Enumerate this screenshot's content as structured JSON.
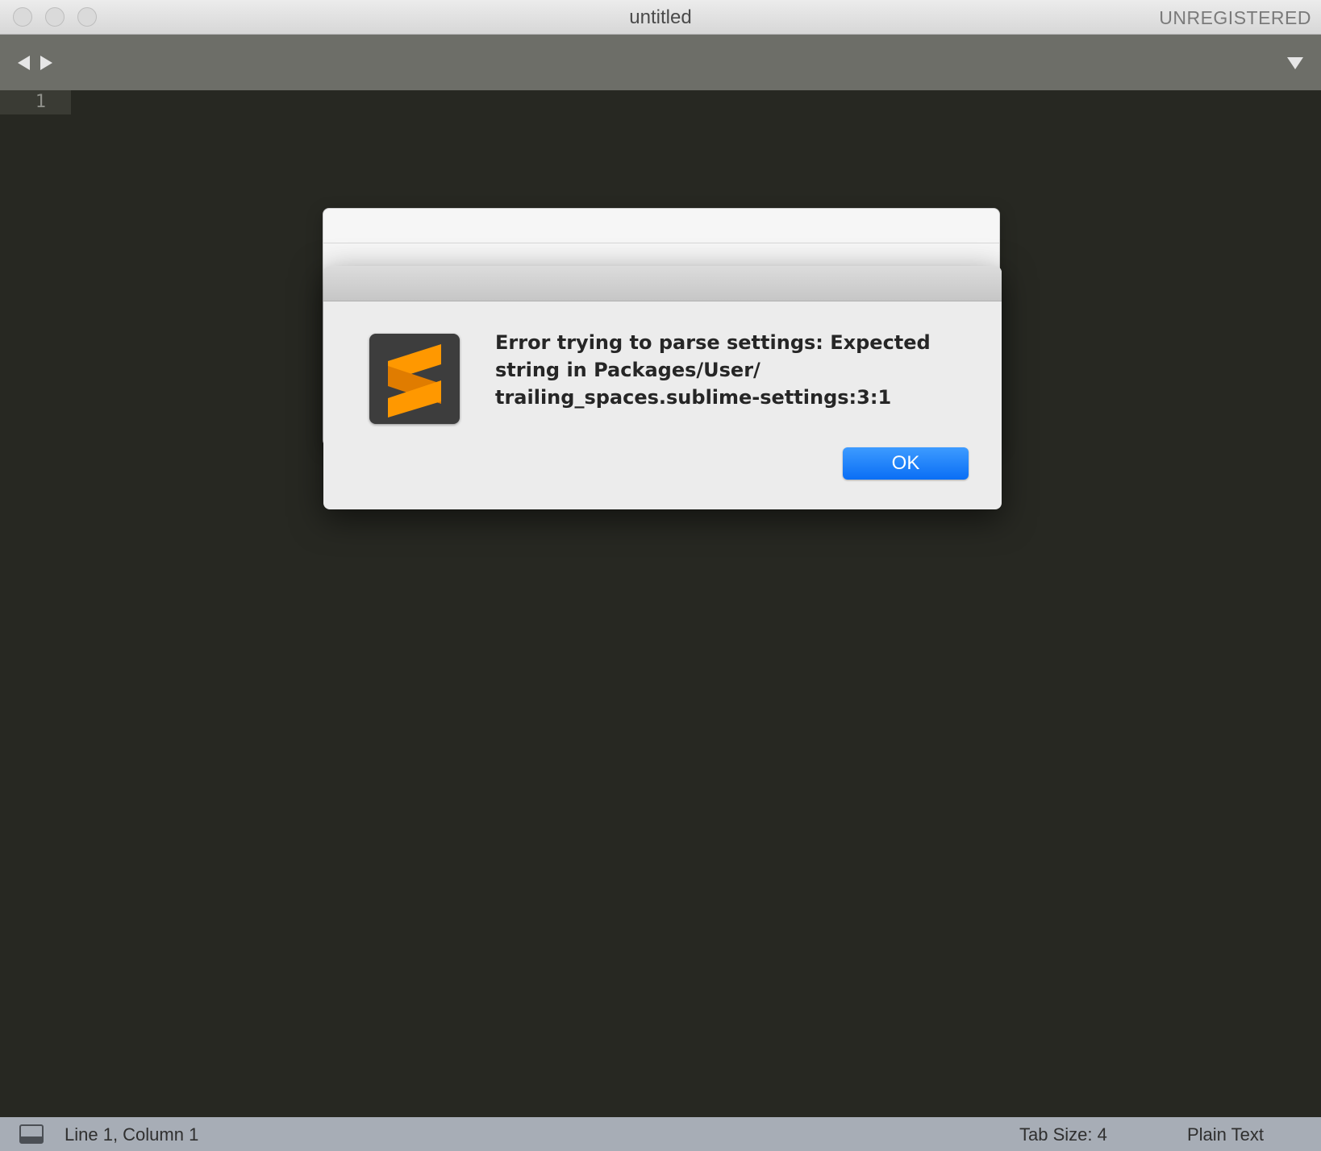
{
  "window": {
    "title": "untitled",
    "registration_status": "UNREGISTERED"
  },
  "editor": {
    "line_numbers": [
      "1"
    ]
  },
  "dialog": {
    "message_lines": [
      "Error trying to parse settings: Expected",
      "string in Packages/User/",
      "trailing_spaces.sublime-settings:3:1"
    ],
    "ok_label": "OK",
    "icon": "sublime-text-logo-icon"
  },
  "status_bar": {
    "position": "Line 1, Column 1",
    "tab_size": "Tab Size: 4",
    "syntax": "Plain Text"
  },
  "colors": {
    "editor_bg": "#272822",
    "tabbar_bg": "#6d6e68",
    "statusbar_bg": "#a7adb6",
    "accent_button": "#0a6ef5",
    "logo_orange": "#ff9800"
  }
}
